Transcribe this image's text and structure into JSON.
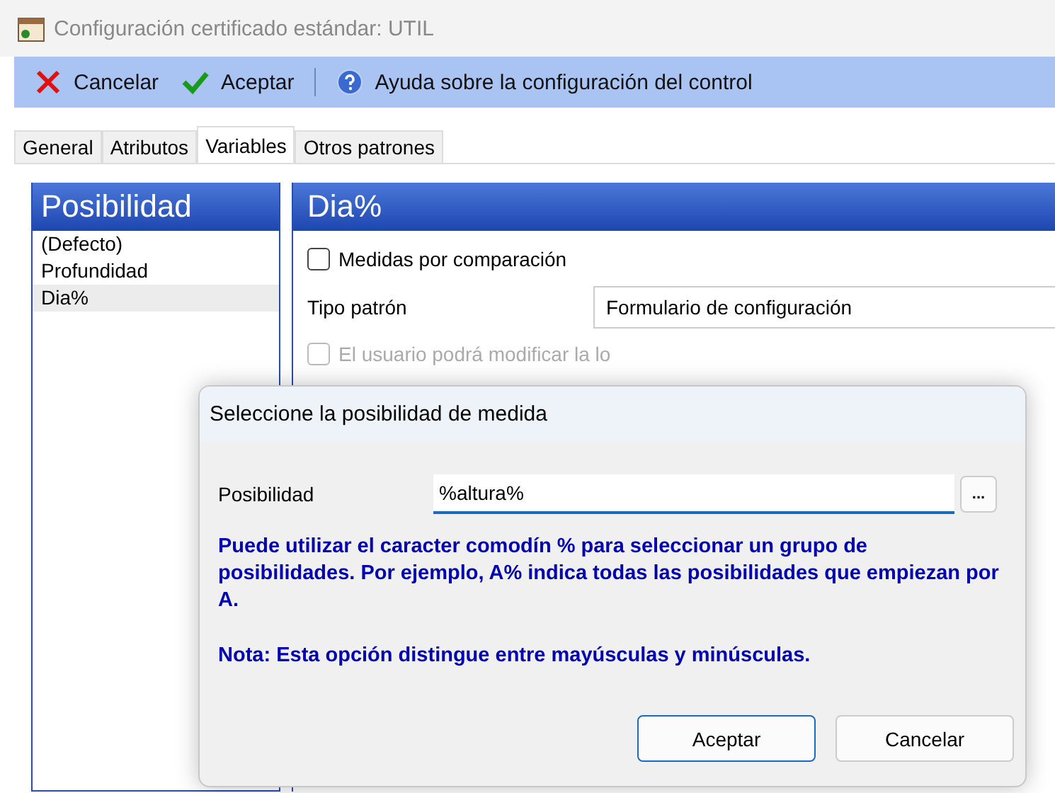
{
  "window": {
    "title": "Configuración certificado estándar: UTIL"
  },
  "toolbar": [
    {
      "kind": "cancel",
      "label": "Cancelar"
    },
    {
      "kind": "accept",
      "label": "Aceptar"
    },
    {
      "kind": "help",
      "label": "Ayuda sobre la configuración del control"
    }
  ],
  "tabs": [
    {
      "label": "General",
      "selected": false
    },
    {
      "label": "Atributos",
      "selected": false
    },
    {
      "label": "Variables",
      "selected": true
    },
    {
      "label": "Otros patrones",
      "selected": false
    }
  ],
  "sidebar": {
    "title": "Posibilidad",
    "items": [
      {
        "label": "(Defecto)",
        "selected": false
      },
      {
        "label": "Profundidad",
        "selected": false
      },
      {
        "label": "Dia%",
        "selected": true
      }
    ]
  },
  "detail": {
    "title": "Dia%",
    "compare": {
      "label": "Medidas por comparación",
      "checked": false,
      "disabled": false
    },
    "pattern_type": {
      "label": "Tipo patrón",
      "value": "Formulario de configuración"
    },
    "user_edit": {
      "label": "El usuario podrá modificar la lo",
      "checked": false,
      "disabled": true
    }
  },
  "dialog": {
    "title": "Seleccione la posibilidad de medida",
    "field": {
      "label": "Posibilidad",
      "value": "%altura%",
      "browse": "..."
    },
    "hint": "Puede utilizar el caracter comodín % para seleccionar un grupo de posibilidades. Por ejemplo, A% indica todas las posibilidades que empiezan por A.",
    "note": "Nota: Esta opción distingue entre mayúsculas y minúsculas.",
    "buttons": [
      {
        "label": "Aceptar",
        "kind": "default"
      },
      {
        "label": "Cancelar",
        "kind": "normal"
      }
    ]
  }
}
